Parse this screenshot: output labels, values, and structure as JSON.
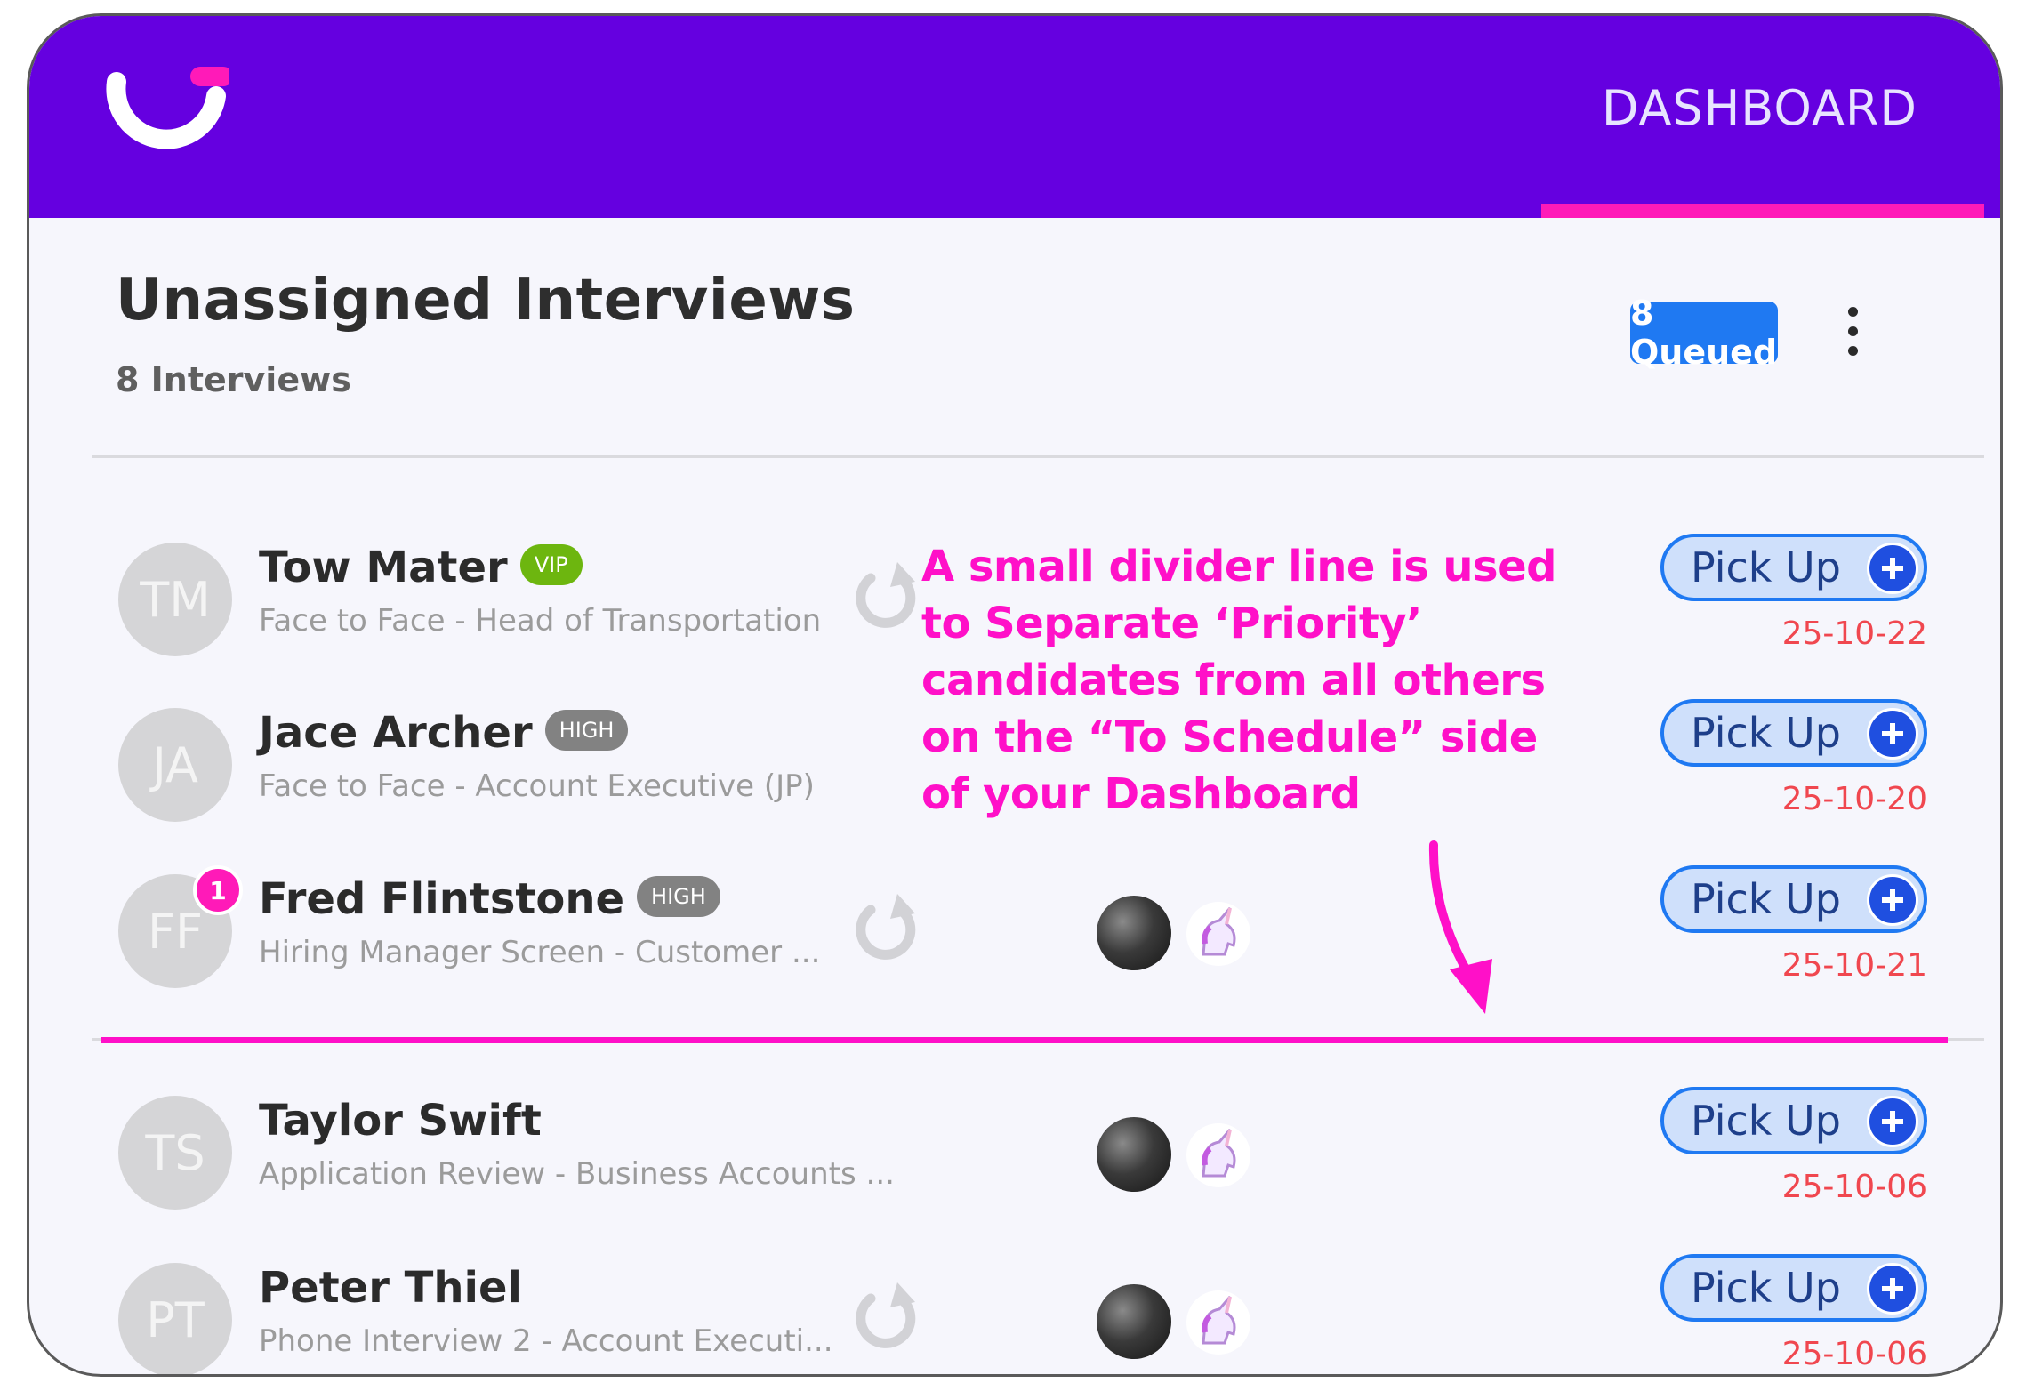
{
  "header": {
    "nav_label": "DASHBOARD"
  },
  "panel": {
    "title": "Unassigned Interviews",
    "subtitle": "8 Interviews",
    "queued_label": "8 Queued"
  },
  "interviews": [
    {
      "initials": "TM",
      "name": "Tow Mater",
      "badge": "VIP",
      "detail": "Face to Face - Head of Transportation",
      "date": "25-10-22",
      "pickup_label": "Pick Up"
    },
    {
      "initials": "JA",
      "name": "Jace Archer",
      "badge": "HIGH",
      "detail": "Face to Face - Account Executive (JP)",
      "date": "25-10-20",
      "pickup_label": "Pick Up"
    },
    {
      "initials": "FF",
      "name": "Fred Flintstone",
      "badge": "HIGH",
      "notification_count": "1",
      "detail": "Hiring Manager Screen - Customer ...",
      "date": "25-10-21",
      "pickup_label": "Pick Up"
    },
    {
      "initials": "TS",
      "name": "Taylor Swift",
      "detail": "Application Review - Business Accounts ...",
      "date": "25-10-06",
      "pickup_label": "Pick Up"
    },
    {
      "initials": "PT",
      "name": "Peter Thiel",
      "detail": "Phone Interview 2 - Account Executi...",
      "date": "25-10-06",
      "pickup_label": "Pick Up"
    }
  ],
  "annotation": {
    "text": "A small divider line is used\nto Separate ‘Priority’\ncandidates from all others\non the “To Schedule” side\nof your Dashboard"
  },
  "colors": {
    "topbar": "#6500e0",
    "accent_pink": "#ff1ab8",
    "annotation_pink": "#ff10c8",
    "primary_blue": "#1f79f2",
    "date_red": "#f0474f",
    "vip_green": "#6db60f",
    "high_gray": "#828282"
  }
}
